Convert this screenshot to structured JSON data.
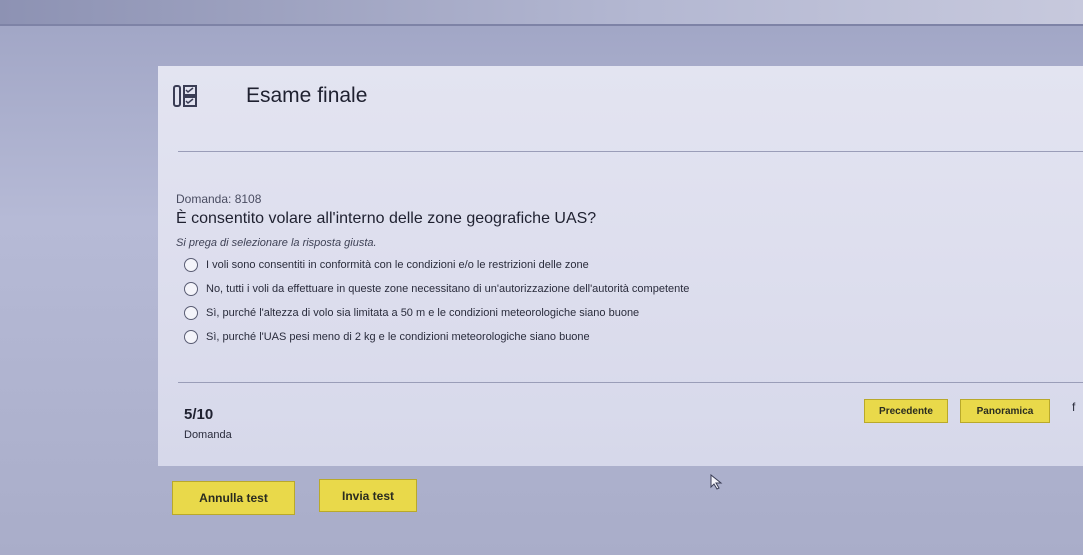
{
  "page_title": "Esame finale",
  "question": {
    "number_label": "Domanda: 8108",
    "text": "È consentito volare all'interno delle zone geografiche UAS?",
    "instruction": "Si prega di selezionare la risposta giusta.",
    "options": [
      "I voli sono consentiti in conformità con le condizioni e/o le restrizioni delle zone",
      "No, tutti i voli da effettuare in queste zone necessitano di un'autorizzazione dell'autorità competente",
      "Sì, purché l'altezza di volo sia limitata a 50 m e le condizioni meteorologiche siano buone",
      "Sì, purché l'UAS pesi meno di 2 kg e le condizioni meteorologiche siano buone"
    ]
  },
  "progress": {
    "count": "5/10",
    "label": "Domanda"
  },
  "nav": {
    "prev_label": "Precedente",
    "overview_label": "Panoramica",
    "edge_mark": "f"
  },
  "actions": {
    "cancel_label": "Annulla test",
    "submit_label": "Invia test"
  },
  "icons": {
    "header": "quiz-list-icon",
    "pointer": "mouse-cursor-icon"
  },
  "colors": {
    "button": "#e9d94a",
    "panel": "#e0e1ef"
  }
}
